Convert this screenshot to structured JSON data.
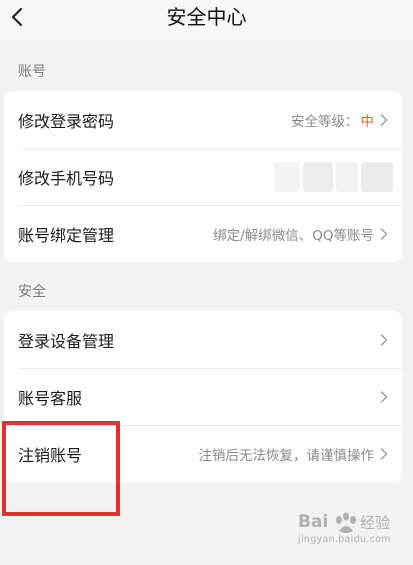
{
  "nav": {
    "title": "安全中心"
  },
  "sections": [
    {
      "title": "账号",
      "items": [
        {
          "label": "修改登录密码",
          "value_prefix": "安全等级：",
          "value_level": "中"
        },
        {
          "label": "修改手机号码",
          "value": ""
        },
        {
          "label": "账号绑定管理",
          "value": "绑定/解绑微信、QQ等账号"
        }
      ]
    },
    {
      "title": "安全",
      "items": [
        {
          "label": "登录设备管理",
          "value": ""
        },
        {
          "label": "账号客服",
          "value": ""
        },
        {
          "label": "注销账号",
          "value": "注销后无法恢复，请谨慎操作"
        }
      ]
    }
  ],
  "colors": {
    "accent": "#ff5a1f",
    "highlight": "#e3302f",
    "background": "#f2f2f2",
    "card": "#ffffff"
  },
  "icons": [
    "back-arrow-icon",
    "chevron-right-icon",
    "baidu-paw-icon"
  ],
  "watermark": {
    "brand": "Bai",
    "mark": "经验",
    "sub": "jingyan.baidu.com"
  }
}
